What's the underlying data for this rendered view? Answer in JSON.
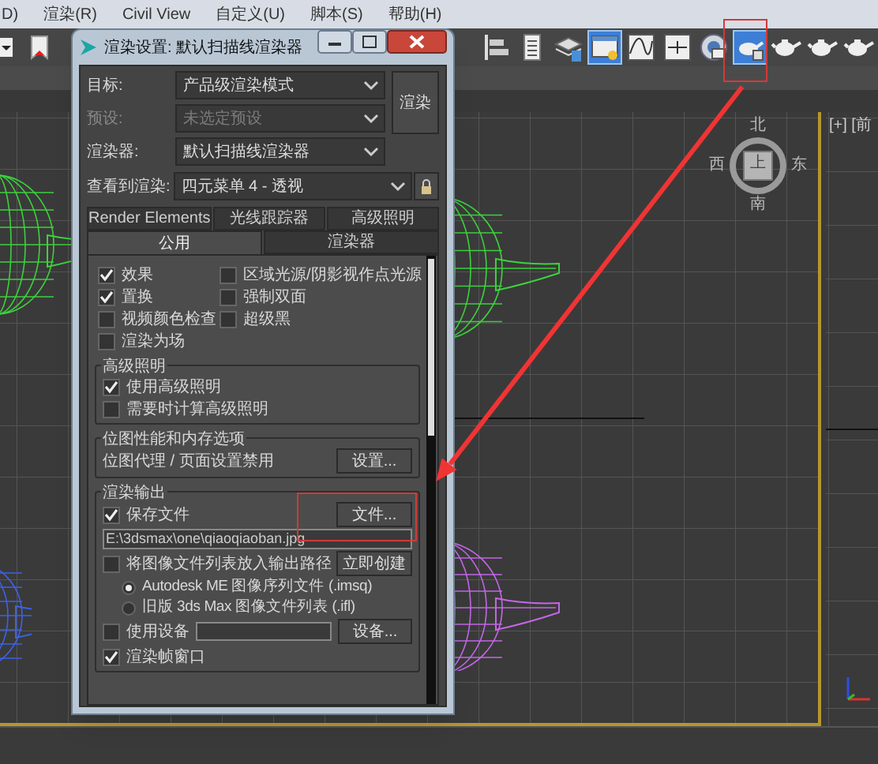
{
  "menu_bar": {
    "items": [
      {
        "label": "D)"
      },
      {
        "label": "渲染(R)"
      },
      {
        "label": "Civil View"
      },
      {
        "label": "自定义(U)"
      },
      {
        "label": "脚本(S)"
      },
      {
        "label": "帮助(H)"
      }
    ]
  },
  "toolbar": {
    "left_tools": [
      {
        "kind": "dropdown",
        "selected": false
      },
      {
        "kind": "flag",
        "selected": false
      }
    ],
    "right_tools": [
      {
        "kind": "align",
        "selected": false
      },
      {
        "kind": "list",
        "selected": false
      },
      {
        "kind": "layers",
        "selected": false
      },
      {
        "kind": "window",
        "selected": true
      },
      {
        "kind": "curve",
        "selected": false
      },
      {
        "kind": "frame",
        "selected": false
      },
      {
        "kind": "gear",
        "selected": false
      },
      {
        "kind": "teapot_setup",
        "selected": true
      },
      {
        "kind": "teapot",
        "selected": false
      },
      {
        "kind": "teapot",
        "selected": false
      },
      {
        "kind": "teapot",
        "selected": false
      }
    ]
  },
  "viewports": {
    "objects": [
      {
        "kind": "teapot",
        "color": "#3cd23c"
      },
      {
        "kind": "teapot",
        "color": "#3cd23c"
      },
      {
        "kind": "teapot",
        "color": "#3d62e6"
      },
      {
        "kind": "teapot",
        "color": "#c466e8"
      }
    ],
    "view_cube": {
      "face": "上",
      "north": "北",
      "east": "东",
      "south": "南",
      "west": "西"
    },
    "right_label": "[+] [前"
  },
  "dialog": {
    "title": "渲染设置: 默认扫描线渲染器",
    "fields": [
      {
        "label": "目标:",
        "value": "产品级渲染模式",
        "disabled": false
      },
      {
        "label": "预设:",
        "value": "未选定预设",
        "disabled": true
      },
      {
        "label": "渲染器:",
        "value": "默认扫描线渲染器",
        "disabled": false
      }
    ],
    "render_button": "渲染",
    "view_to_render": {
      "label": "查看到渲染:",
      "value": "四元菜单 4 - 透视"
    },
    "tab_rows": [
      [
        {
          "label": "Render Elements",
          "selected": false
        },
        {
          "label": "光线跟踪器",
          "selected": false
        },
        {
          "label": "高级照明",
          "selected": false
        }
      ],
      [
        {
          "label": "公用",
          "selected": true
        },
        {
          "label": "渲染器",
          "selected": false
        }
      ]
    ],
    "options": [
      {
        "label": "效果",
        "checked": true
      },
      {
        "label": "区域光源/阴影视作点光源",
        "checked": false
      },
      {
        "label": "置换",
        "checked": true
      },
      {
        "label": "强制双面",
        "checked": false
      },
      {
        "label": "视频颜色检查",
        "checked": false
      },
      {
        "label": "超级黑",
        "checked": false
      },
      {
        "label": "渲染为场",
        "checked": false
      }
    ],
    "advanced_lighting": {
      "title": "高级照明",
      "options": [
        {
          "label": "使用高级照明",
          "checked": true
        },
        {
          "label": "需要时计算高级照明",
          "checked": false
        }
      ]
    },
    "bitmap": {
      "title": "位图性能和内存选项",
      "text": "位图代理 / 页面设置禁用",
      "button": "设置..."
    },
    "render_output": {
      "title": "渲染输出",
      "save_file": {
        "label": "保存文件",
        "checked": true
      },
      "files_button": "文件...",
      "path": "E:\\3dsmax\\one\\qiaoqiaoban.jpg",
      "put_list": {
        "label": "将图像文件列表放入输出路径",
        "checked": false
      },
      "create_button": "立即创建",
      "formats": [
        {
          "label": "Autodesk ME 图像序列文件 (.imsq)",
          "selected": true
        },
        {
          "label": "旧版 3ds Max 图像文件列表 (.ifl)",
          "selected": false
        }
      ],
      "use_device": {
        "label": "使用设备",
        "checked": false
      },
      "devices_button": "设备...",
      "render_frame_window": {
        "label": "渲染帧窗口",
        "checked": true
      }
    }
  }
}
